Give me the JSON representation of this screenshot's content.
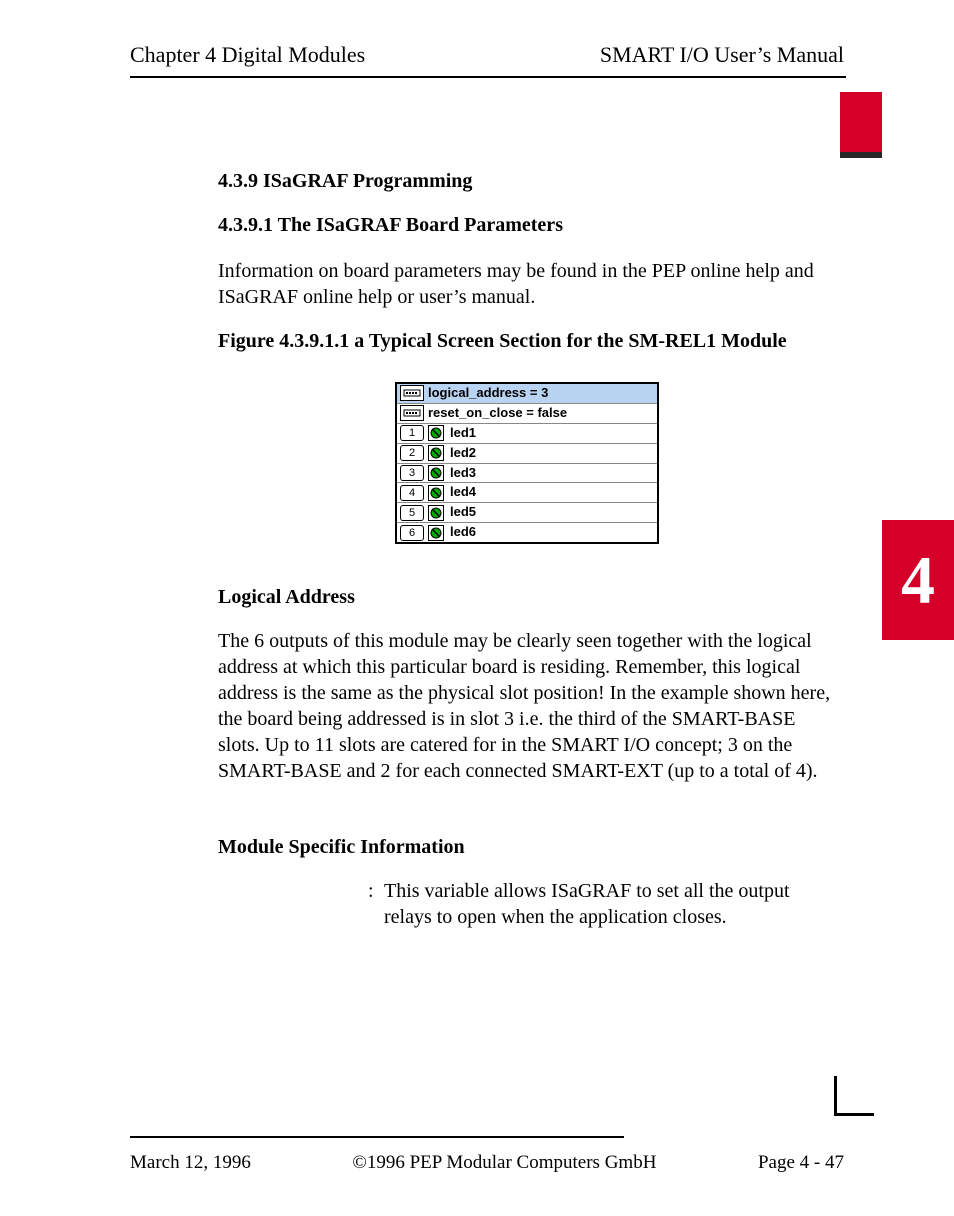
{
  "running_head": {
    "left": "Chapter 4 Digital Modules",
    "right": "SMART I/O User’s Manual"
  },
  "side_tab": "4",
  "section": {
    "h1": "4.3.9 ISaGRAF Programming",
    "h2": "4.3.9.1 The ISaGRAF Board Parameters",
    "intro": "Information on board parameters may be found in the PEP online help and ISaGRAF online help or user’s manual.",
    "fig_caption": "Figure 4.3.9.1.1 a Typical Screen Section for the SM-REL1 Module"
  },
  "board": {
    "params": [
      {
        "label": "logical_address = 3"
      },
      {
        "label": "reset_on_close = false"
      }
    ],
    "signals": [
      {
        "index": "1",
        "name": "led1"
      },
      {
        "index": "2",
        "name": "led2"
      },
      {
        "index": "3",
        "name": "led3"
      },
      {
        "index": "4",
        "name": "led4"
      },
      {
        "index": "5",
        "name": "led5"
      },
      {
        "index": "6",
        "name": "led6"
      }
    ]
  },
  "logical_address": {
    "heading": "Logical Address",
    "body": "The 6 outputs of this module may be clearly seen together with the logical address at which this particular board is residing. Remember, this logical address is the same as the physical slot position! In the example shown here, the board being addressed is in slot 3 i.e. the third of the SMART-BASE slots. Up to 11 slots are catered for in the SMART I/O concept; 3 on the SMART-BASE and 2 for each connected SMART-EXT (up to a total of 4)."
  },
  "module_info": {
    "heading": "Module Specific Information",
    "desc": "This variable allows ISaGRAF to set all the output relays to open when the application closes."
  },
  "footer": {
    "left": "March 12, 1996",
    "center": "©1996 PEP Modular Computers GmbH",
    "right": "Page 4 - 47"
  }
}
